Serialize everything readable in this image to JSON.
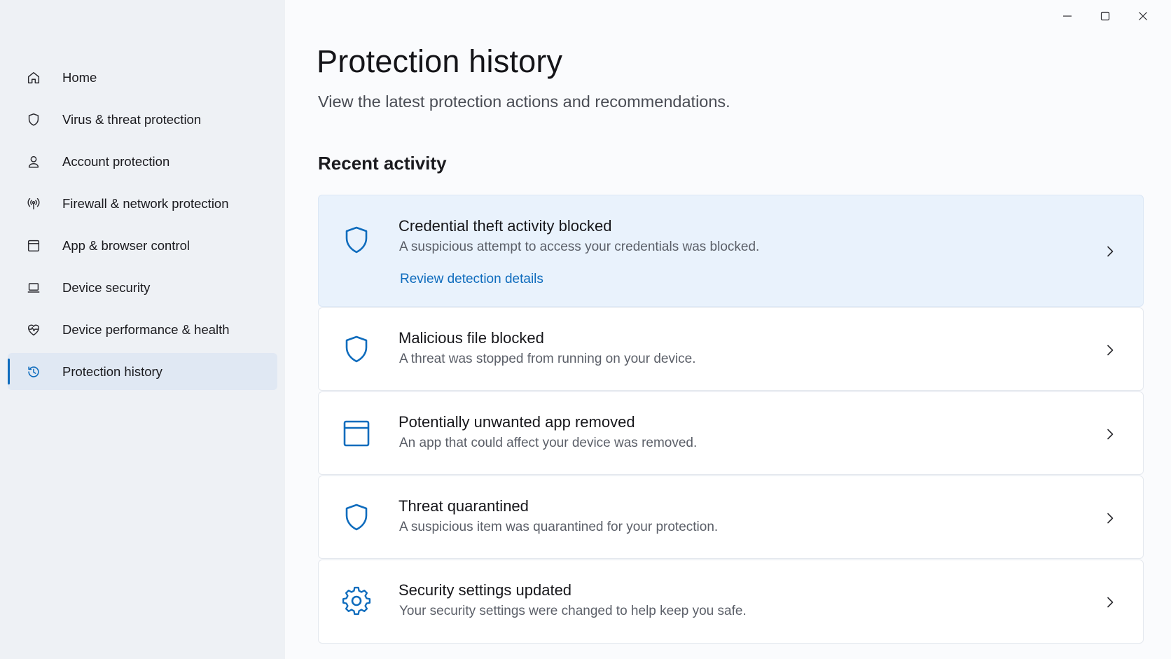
{
  "window": {
    "controls": [
      "minimize-icon",
      "maximize-icon",
      "close-icon"
    ]
  },
  "sidebar": {
    "items": [
      {
        "label": "Home",
        "icon": "home-icon",
        "active": false
      },
      {
        "label": "Virus & threat protection",
        "icon": "shield-icon",
        "active": false
      },
      {
        "label": "Account protection",
        "icon": "person-icon",
        "active": false
      },
      {
        "label": "Firewall & network protection",
        "icon": "antenna-icon",
        "active": false
      },
      {
        "label": "App & browser control",
        "icon": "browser-window-icon",
        "active": false
      },
      {
        "label": "Device security",
        "icon": "laptop-icon",
        "active": false
      },
      {
        "label": "Device performance & health",
        "icon": "heart-pulse-icon",
        "active": false
      },
      {
        "label": "Protection history",
        "icon": "history-icon",
        "active": true
      }
    ]
  },
  "main": {
    "title": "Protection history",
    "subtitle": "View the latest protection actions and recommendations.",
    "section_title": "Recent activity",
    "activities": [
      {
        "title": "Credential theft activity blocked",
        "description": "A suspicious attempt to access your credentials was blocked.",
        "link": "Review detection details",
        "icon": "shield-icon",
        "highlighted": true
      },
      {
        "title": "Malicious file blocked",
        "description": "A threat was stopped from running on your device.",
        "icon": "shield-icon",
        "highlighted": false
      },
      {
        "title": "Potentially unwanted app removed",
        "description": "An app that could affect your device was removed.",
        "icon": "app-window-icon",
        "highlighted": false
      },
      {
        "title": "Threat quarantined",
        "description": "A suspicious item was quarantined for your protection.",
        "icon": "shield-icon",
        "highlighted": false
      },
      {
        "title": "Security settings updated",
        "description": "Your security settings were changed to help keep you safe.",
        "icon": "gear-icon",
        "highlighted": false
      }
    ]
  },
  "colors": {
    "accent": "#0f6cbd",
    "sidebar_bg": "#eef1f5",
    "highlight_card": "#e9f2fc"
  }
}
